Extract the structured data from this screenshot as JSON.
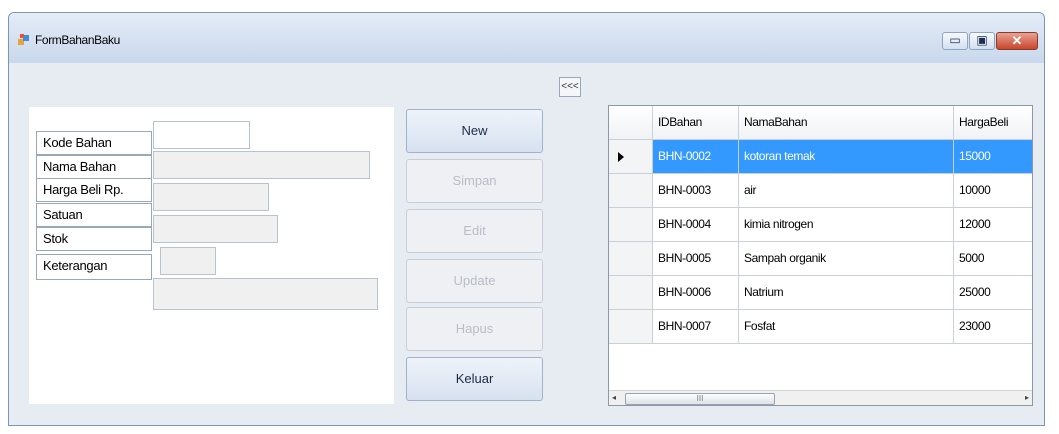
{
  "window": {
    "title": "FormBahanBaku",
    "minimize": "▭",
    "maximize": "▣",
    "close": "✕"
  },
  "toggle_label": "<<<",
  "form": {
    "labels": [
      "Kode Bahan",
      "Nama Bahan",
      "Harga Beli Rp.",
      "Satuan",
      "Stok",
      "Keterangan"
    ],
    "values": {
      "kode": "",
      "nama": "",
      "harga": "",
      "satuan": "",
      "stok": "",
      "keterangan": ""
    }
  },
  "buttons": {
    "new": "New",
    "simpan": "Simpan",
    "edit": "Edit",
    "update": "Update",
    "hapus": "Hapus",
    "keluar": "Keluar"
  },
  "grid": {
    "columns": [
      "IDBahan",
      "NamaBahan",
      "HargaBeli"
    ],
    "rows": [
      [
        "BHN-0002",
        "kotoran temak",
        "15000"
      ],
      [
        "BHN-0003",
        "air",
        "10000"
      ],
      [
        "BHN-0004",
        "kimia nitrogen",
        "12000"
      ],
      [
        "BHN-0005",
        "Sampah organik",
        "5000"
      ],
      [
        "BHN-0006",
        "Natrium",
        "25000"
      ],
      [
        "BHN-0007",
        "Fosfat",
        "23000"
      ]
    ],
    "scroll_left": "◂",
    "scroll_right": "▸",
    "scroll_grip": "III"
  },
  "colors": {
    "selection": "#3399ff",
    "titlebar": "#d4e0f0",
    "close_button": "#c9462c"
  }
}
